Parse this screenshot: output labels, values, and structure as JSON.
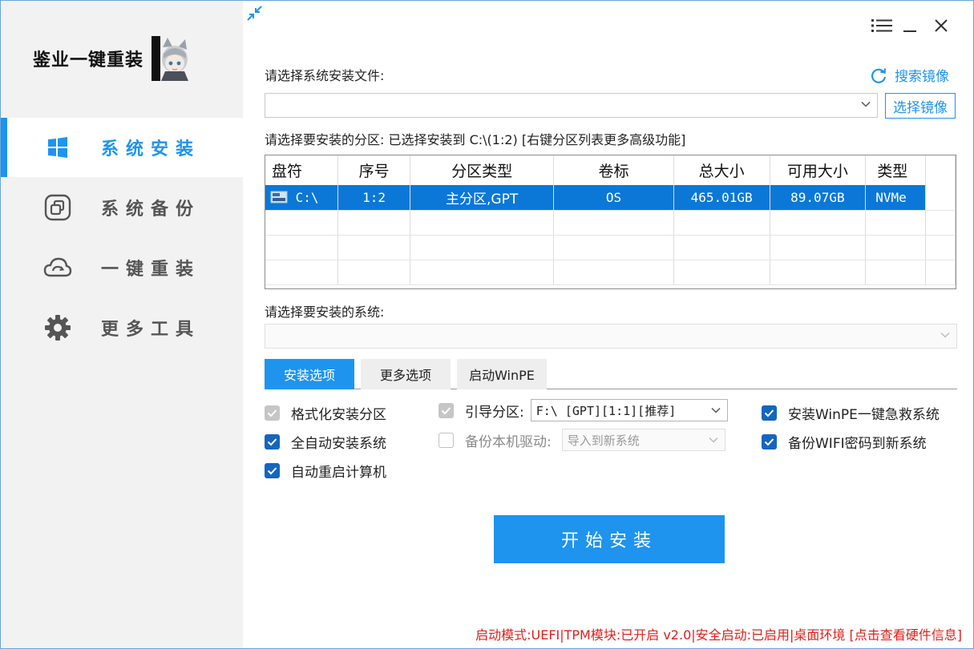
{
  "app": {
    "brand": "鉴业一键重装"
  },
  "sidebar": {
    "items": [
      {
        "label": "系统安装",
        "icon": "windows-icon",
        "active": true
      },
      {
        "label": "系统备份",
        "icon": "backup-icon",
        "active": false
      },
      {
        "label": "一键重装",
        "icon": "cloud-icon",
        "active": false
      },
      {
        "label": "更多工具",
        "icon": "gear-icon",
        "active": false
      }
    ]
  },
  "main": {
    "install_file_label": "请选择系统安装文件:",
    "search_image_label": "搜索镜像",
    "image_path_value": "",
    "select_image_button": "选择镜像",
    "partition_label": "请选择要安装的分区: 已选择安装到 C:\\(1:2) [右键分区列表更多高级功能]",
    "partition_table": {
      "headers": [
        "盘符",
        "序号",
        "分区类型",
        "卷标",
        "总大小",
        "可用大小",
        "类型"
      ],
      "rows": [
        {
          "drive": "C:\\",
          "index": "1:2",
          "part_type": "主分区,GPT",
          "volume": "OS",
          "total": "465.01GB",
          "free": "89.07GB",
          "type": "NVMe",
          "selected": true
        }
      ]
    },
    "system_label": "请选择要安装的系统:",
    "system_value": "",
    "tabs": [
      "安装选项",
      "更多选项",
      "启动WinPE"
    ],
    "active_tab": 0,
    "options": {
      "format_partition": {
        "label": "格式化安装分区",
        "checked": true,
        "disabled": true
      },
      "auto_install": {
        "label": "全自动安装系统",
        "checked": true,
        "disabled": false
      },
      "auto_reboot": {
        "label": "自动重启计算机",
        "checked": true,
        "disabled": false
      },
      "boot_partition": {
        "label": "引导分区:",
        "checked": true,
        "disabled": true,
        "value": "F:\\ [GPT][1:1][推荐]"
      },
      "backup_drivers": {
        "label": "备份本机驱动:",
        "checked": false,
        "disabled": true,
        "value": "导入到新系统"
      },
      "install_winpe": {
        "label": "安装WinPE一键急救系统",
        "checked": true,
        "disabled": false
      },
      "backup_wifi": {
        "label": "备份WIFI密码到新系统",
        "checked": true,
        "disabled": false
      }
    },
    "start_button": "开始安装"
  },
  "status_bar": {
    "text": "启动模式:UEFI|TPM模块:已开启 v2.0|安全启动:已启用|桌面环境 [点击查看硬件信息]"
  },
  "colors": {
    "accent": "#1e94ee",
    "selection": "#0b78d7",
    "checkbox": "#1565c0",
    "status_text": "#e0201a",
    "sidebar_bg": "#f2f2f2"
  }
}
